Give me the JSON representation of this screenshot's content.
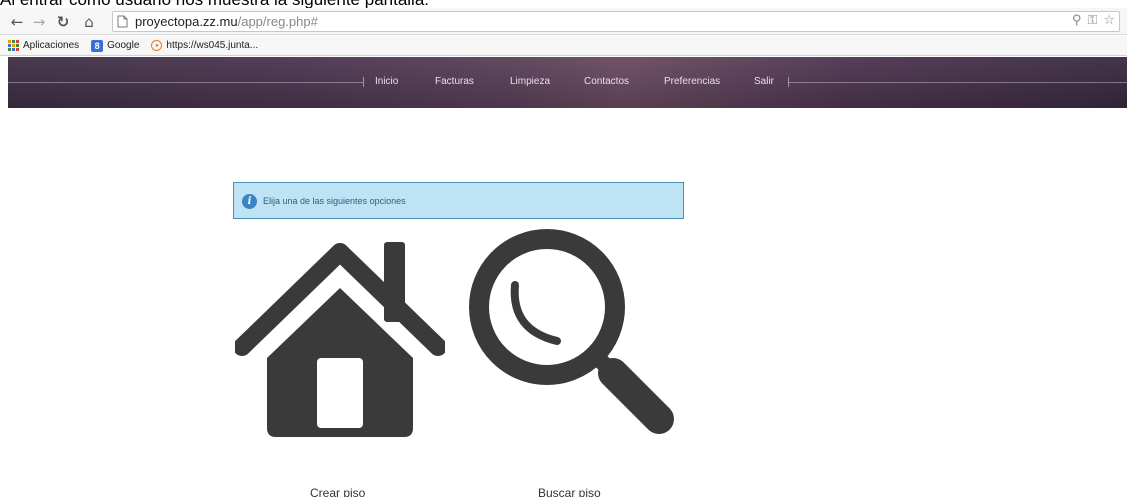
{
  "document_caption": "Al entrar como usuario nos muestra la siguiente pantalla:",
  "browser": {
    "url_host": "proyectopa.zz.mu",
    "url_path": "/app/reg.php#",
    "bookmarks": [
      {
        "label": "Aplicaciones",
        "icon": "apps-grid-icon"
      },
      {
        "label": "Google",
        "icon": "google-icon"
      },
      {
        "label": "https://ws045.junta...",
        "icon": "junta-icon"
      }
    ]
  },
  "site_nav": {
    "items": [
      "Inicio",
      "Facturas",
      "Limpieza",
      "Contactos",
      "Preferencias",
      "Salir"
    ]
  },
  "info_box": {
    "icon": "info-icon",
    "message": "Elija una de las siguientes opciones"
  },
  "options": [
    {
      "label": "Crear piso",
      "icon": "house-icon"
    },
    {
      "label": "Buscar piso",
      "icon": "magnifier-icon"
    }
  ],
  "colors": {
    "info_background": "#bde3f4",
    "info_border": "#4b8fb3",
    "icon_dark": "#3a3a3a",
    "nav_background": "#4a3550"
  }
}
